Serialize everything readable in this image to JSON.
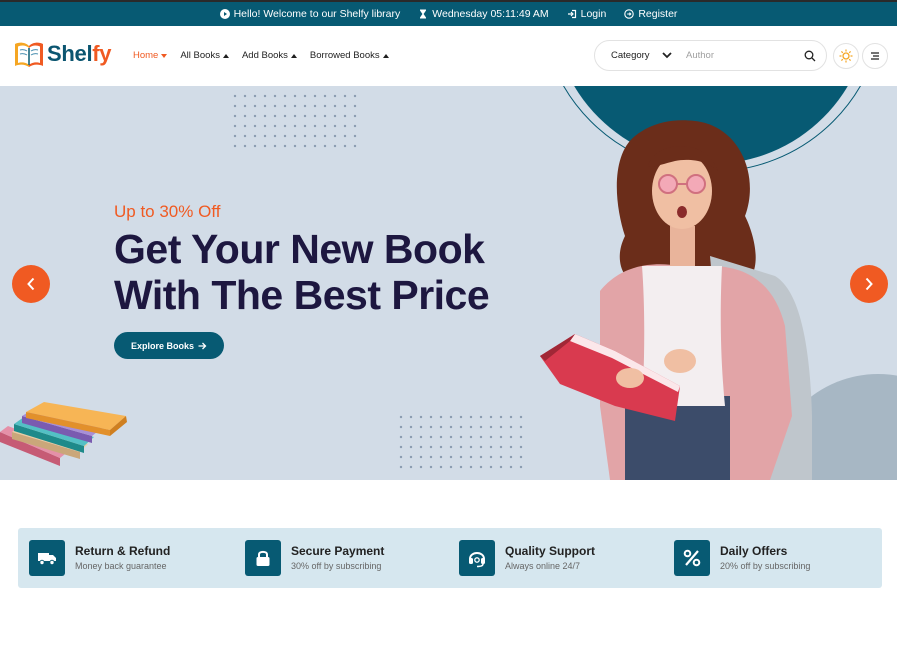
{
  "topbar": {
    "welcome": "Hello! Welcome to our Shelfy library",
    "datetime": "Wednesday 05:11:49 AM",
    "login": "Login",
    "register": "Register"
  },
  "brand": {
    "name_primary": "Shel",
    "name_accent": "fy"
  },
  "nav": {
    "items": [
      {
        "label": "Home",
        "active": true
      },
      {
        "label": "All Books"
      },
      {
        "label": "Add Books"
      },
      {
        "label": "Borrowed Books"
      }
    ]
  },
  "search": {
    "category": "Category",
    "placeholder": "Author"
  },
  "hero": {
    "offer": "Up to 30% Off",
    "headline_line1": "Get Your New Book",
    "headline_line2": "With The Best Price",
    "cta": "Explore Books"
  },
  "features": [
    {
      "title": "Return & Refund",
      "subtitle": "Money back guarantee",
      "icon": "truck-icon"
    },
    {
      "title": "Secure Payment",
      "subtitle": "30% off by subscribing",
      "icon": "lock-icon"
    },
    {
      "title": "Quality Support",
      "subtitle": "Always online 24/7",
      "icon": "headset-icon"
    },
    {
      "title": "Daily Offers",
      "subtitle": "20% off by subscribing",
      "icon": "percent-icon"
    }
  ],
  "colors": {
    "primary": "#075a73",
    "accent": "#f05a22",
    "hero_bg": "#d2dce7",
    "heading": "#1d1740",
    "feature_bg": "#d6e7ef"
  }
}
